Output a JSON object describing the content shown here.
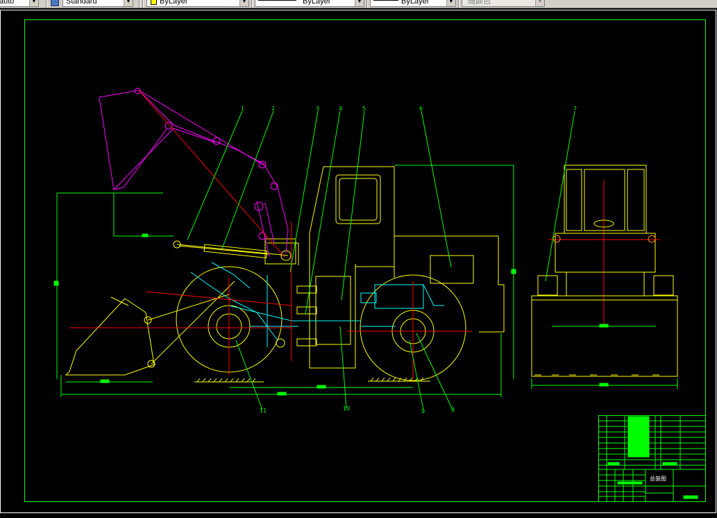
{
  "toolbar": {
    "textstyle_value": "Standard",
    "dimstyle_value": "auto",
    "color_value": "ByLayer",
    "linetype_value": "ByLayer",
    "lineweight_value": "ByLayer",
    "plotstyle_value": "随颜色"
  },
  "drawing": {
    "callouts": [
      "1",
      "2",
      "3",
      "4",
      "5",
      "6",
      "7",
      "8",
      "9",
      "10",
      "11"
    ],
    "title_block": {
      "drawing_title": "总装图"
    }
  },
  "colors": {
    "frame": "#00ff00",
    "outline": "#ffff00",
    "boom": "#ff00ff",
    "hydraulics": "#00ffff",
    "centerline": "#ff0000",
    "toolbar_bg": "#d4d0c8"
  }
}
